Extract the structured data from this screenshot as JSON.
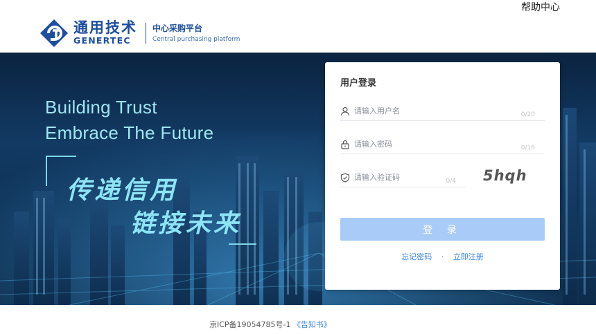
{
  "header": {
    "help_link": "帮助中心",
    "logo_cn": "通用技术",
    "logo_en": "GENERTEC",
    "platform_cn": "中心采购平台",
    "platform_en": "Central purchasing platform"
  },
  "hero": {
    "slogan_en_1": "Building Trust",
    "slogan_en_2": "Embrace The Future",
    "slogan_cn_1": "传递信用",
    "slogan_cn_2": "链接未来"
  },
  "login": {
    "title": "用户登录",
    "username": {
      "placeholder": "请输入用户名",
      "value": "",
      "counter": "0/20",
      "icon": "user-icon"
    },
    "password": {
      "placeholder": "请输入密码",
      "value": "",
      "counter": "0/16",
      "icon": "lock-icon"
    },
    "captcha": {
      "placeholder": "请输入验证码",
      "value": "",
      "counter": "0/4",
      "icon": "shield-check-icon",
      "image_text": "5hqh"
    },
    "submit_label": "登 录",
    "forgot_label": "忘记密码",
    "separator": "·",
    "register_label": "立即注册"
  },
  "footer": {
    "icp": "京ICP备19054785号-1",
    "notice": "《告知书》"
  },
  "colors": {
    "brand": "#1d4ea0",
    "link": "#3a86e0",
    "button": "#a9cbf7",
    "slogan": "#8de4f5"
  }
}
